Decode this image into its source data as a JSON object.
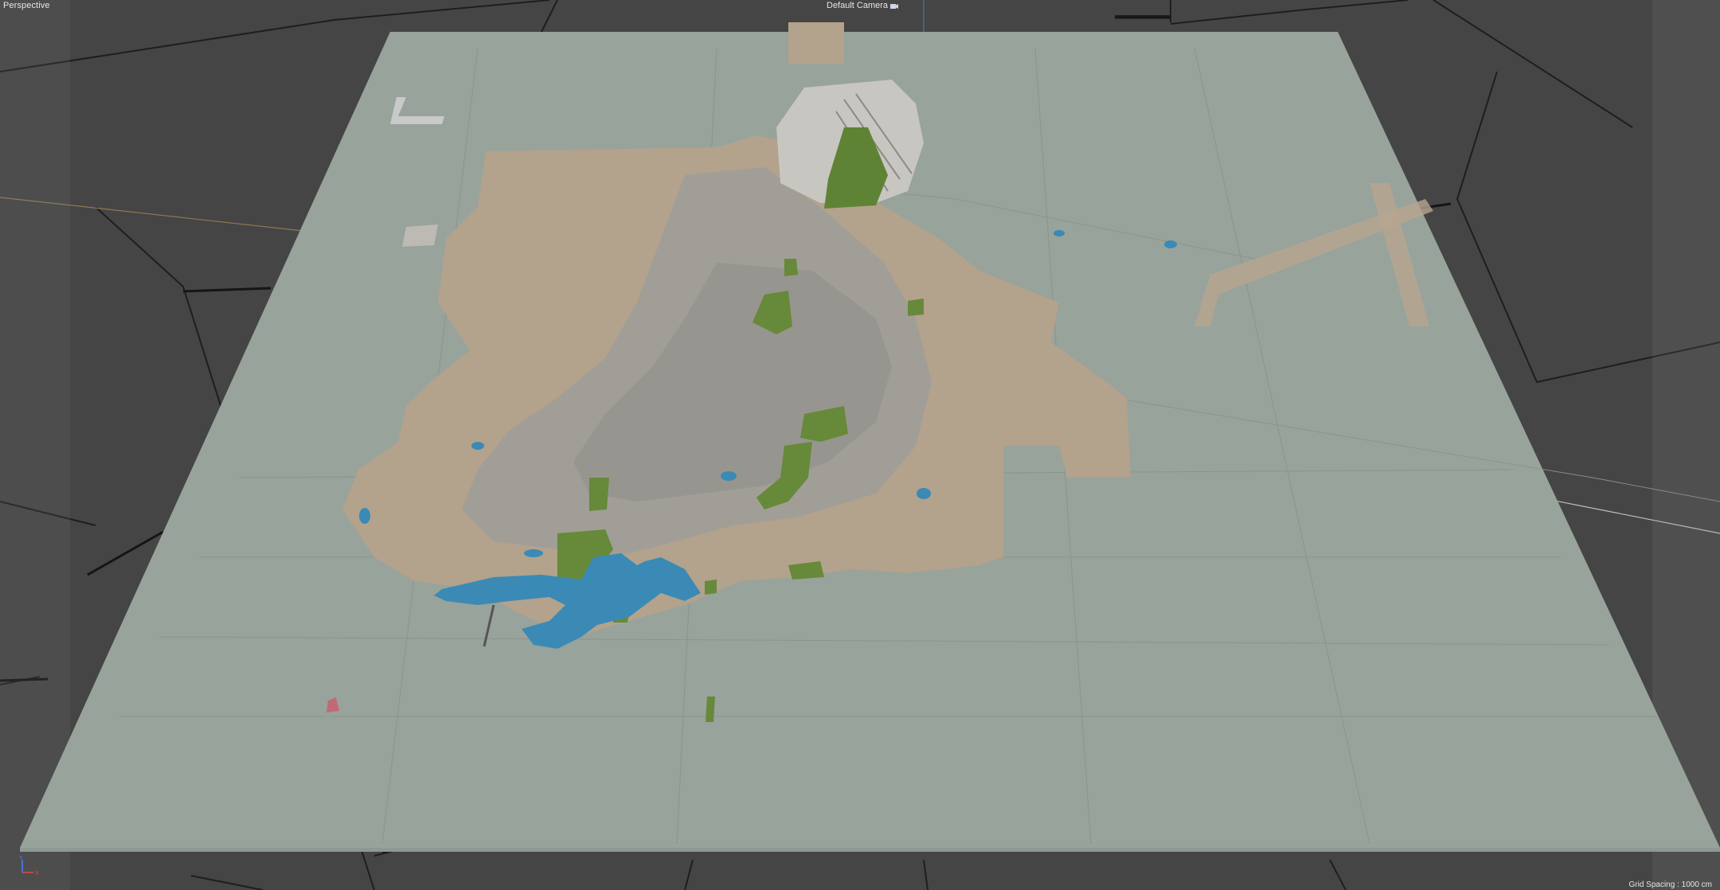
{
  "viewport": {
    "view_mode": "Perspective",
    "camera_name": "Default Camera",
    "grid_spacing": "Grid Spacing : 1000 cm"
  },
  "icons": {
    "camera": "camera-icon",
    "axis_gizmo": "axis-gizmo-icon"
  },
  "axis_gizmo": {
    "x_label": "X",
    "y_label": "Y"
  },
  "colors": {
    "background": "#454545",
    "ground_plane": "#98a39b",
    "urban_area": "#b3a28c",
    "dense_city": "#9d9a94",
    "water": "#3b8bb7",
    "parks": "#6a8a3a",
    "airport": "#c9c7c1",
    "overlay_panels": "#8a8a8a",
    "label_text": "#e6e6e6"
  }
}
